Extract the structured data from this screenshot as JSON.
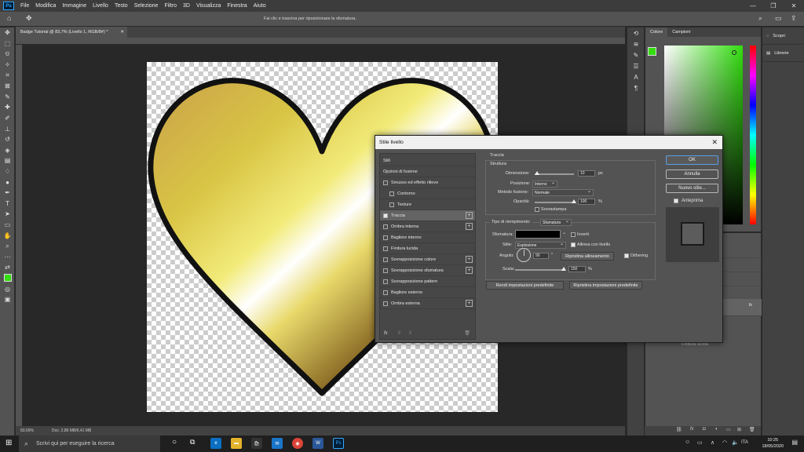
{
  "menubar": {
    "logo": "Ps",
    "items": [
      "File",
      "Modifica",
      "Immagine",
      "Livello",
      "Testo",
      "Selezione",
      "Filtro",
      "3D",
      "Visualizza",
      "Finestra",
      "Aiuto"
    ]
  },
  "options_bar": {
    "hint": "Fai clic e trascina per riposizionare la sfumatura."
  },
  "document": {
    "tab_title": "Badge Tutorial @ 83,7% (Livello 1, RGB/8#) *",
    "zoom": "83,69%",
    "doc_info": "Doc: 2,86 MB/6,41 MB"
  },
  "color_panel": {
    "tabs": [
      "Colore",
      "Campioni"
    ],
    "foreground": "#33dd10"
  },
  "learn_panel": {
    "items": [
      "Scopri",
      "Librerie"
    ]
  },
  "layers_panel": {
    "effect_label": "Finitura lucida",
    "fx_label": "fx"
  },
  "dialog": {
    "title": "Stile livello",
    "close": "✕",
    "styles_header": "Stili",
    "blend_options": "Opzioni di fusione",
    "items": [
      {
        "label": "Smusso ed effetto rilievo",
        "checked": false,
        "plus": false,
        "indent": false
      },
      {
        "label": "Contorno",
        "checked": false,
        "plus": false,
        "indent": true
      },
      {
        "label": "Texture",
        "checked": false,
        "plus": false,
        "indent": true
      },
      {
        "label": "Traccia",
        "checked": true,
        "plus": true,
        "indent": false
      },
      {
        "label": "Ombra interna",
        "checked": false,
        "plus": true,
        "indent": false
      },
      {
        "label": "Bagliore interno",
        "checked": false,
        "plus": false,
        "indent": false
      },
      {
        "label": "Finitura lucida",
        "checked": false,
        "plus": false,
        "indent": false
      },
      {
        "label": "Sovrapposizione colore",
        "checked": false,
        "plus": true,
        "indent": false
      },
      {
        "label": "Sovrapposizione sfumatura",
        "checked": false,
        "plus": true,
        "indent": false
      },
      {
        "label": "Sovrapposizione pattern",
        "checked": false,
        "plus": false,
        "indent": false
      },
      {
        "label": "Bagliore esterno",
        "checked": false,
        "plus": false,
        "indent": false
      },
      {
        "label": "Ombra esterna",
        "checked": false,
        "plus": true,
        "indent": false
      }
    ],
    "fx": "fx",
    "section_title": "Traccia",
    "structure_title": "Struttura",
    "dimensione_label": "Dimensione:",
    "dimensione_value": "10",
    "dimensione_unit": "px",
    "posizione_label": "Posizione:",
    "posizione_value": "Interno",
    "metodo_label": "Metodo fusione:",
    "metodo_value": "Normale",
    "opacita_label": "Opacità:",
    "opacita_value": "100",
    "opacita_unit": "%",
    "sovrastampa": "Sovrastampa",
    "tipo_label": "Tipo di riempimento:",
    "tipo_value": "Sfumatura",
    "sfumatura_label": "Sfumatura:",
    "inverti": "Inverti",
    "stile_label": "Stile:",
    "stile_value": "Esplosione",
    "allinea": "Allinea con livello",
    "angolo_label": "Angolo:",
    "angolo_value": "90",
    "angolo_unit": "°",
    "ripristina_allineamento": "Ripristina allineamento",
    "dithering": "Dithering",
    "scala_label": "Scala:",
    "scala_value": "150",
    "scala_unit": "%",
    "rendi_predefinite": "Rendi impostazioni predefinite",
    "ripristina_predefinite": "Ripristina impostazioni predefinite",
    "ok": "OK",
    "annulla": "Annulla",
    "nuovo_stile": "Nuovo stile...",
    "anteprima": "Anteprima"
  },
  "taskbar": {
    "search_placeholder": "Scrivi qui per eseguire la ricerca",
    "time": "10:25",
    "date": "18/05/2020",
    "lang": "ITA"
  }
}
